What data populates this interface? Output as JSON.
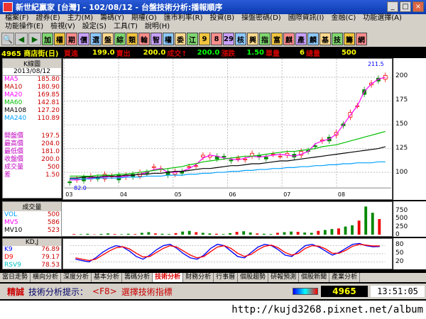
{
  "window": {
    "title": "新世紀贏家 [台灣] - 102/08/12 - 台盤技術分析:播報順序",
    "min": "_",
    "max": "□",
    "close": "×"
  },
  "menu": [
    "檔案(F)",
    "證券(E)",
    "主力(M)",
    "籌碼(Y)",
    "期權(O)",
    "匯市利率(R)",
    "投資(B)",
    "操盤密碼(D)",
    "國際資訊(I)",
    "金融(C)",
    "功能選擇(A)",
    "功能操作(E)",
    "檢視(V)",
    "設定(S)",
    "工具(T)",
    "說明(H)"
  ],
  "toolbar": {
    "icons": [
      "search-icon",
      "back-icon",
      "forward-icon"
    ],
    "buttons": [
      "加",
      "權",
      "期",
      "價",
      "選",
      "盤",
      "綜",
      "類",
      "輪",
      "智",
      "權",
      "委",
      "江",
      "9",
      "8",
      "29",
      "核",
      "興",
      "指",
      "富",
      "麒",
      "產",
      "麟",
      "基",
      "技",
      "籌",
      "網"
    ]
  },
  "info": {
    "code_name": "4965 商店街(日)",
    "buy_label": "買進",
    "buy": "199.0",
    "sell_label": "賣出",
    "sell": "200.0",
    "deal_label": "成交↑",
    "deal": "200.0",
    "change_label": "漲跌",
    "change": "1.50",
    "unit_label": "單量",
    "unit": "6",
    "vol_label": "總量",
    "vol": "500"
  },
  "left_panel": {
    "title": "K線圖",
    "date": "2013/08/12",
    "ma": [
      {
        "label": "MA5",
        "value": "185.80",
        "color": "#ff00ff"
      },
      {
        "label": "MA10",
        "value": "180.90",
        "color": "#c00000"
      },
      {
        "label": "MA20",
        "value": "169.85",
        "color": "#ff00ff"
      },
      {
        "label": "MA60",
        "value": "142.81",
        "color": "#00c000"
      },
      {
        "label": "MA108",
        "value": "127.20",
        "color": "#000000"
      },
      {
        "label": "MA240",
        "value": "110.89",
        "color": "#00a0ff"
      }
    ],
    "prices": [
      {
        "label": "開盤價",
        "value": "197.5"
      },
      {
        "label": "最高價",
        "value": "204.0"
      },
      {
        "label": "最低價",
        "value": "181.0"
      },
      {
        "label": "收盤價",
        "value": "200.0"
      },
      {
        "label": "成交量",
        "value": "500"
      },
      {
        "label": "差",
        "value": "1.50"
      }
    ]
  },
  "chart_data": [
    {
      "type": "line",
      "title": "K線圖",
      "x_ticks": [
        "03",
        "04",
        "05",
        "06",
        "07",
        "08"
      ],
      "annotations": [
        "211.5",
        "82.0"
      ],
      "ylim": [
        85,
        215
      ],
      "y_ticks": [
        100,
        125,
        150,
        175,
        200
      ],
      "series": [
        {
          "name": "MA5",
          "color": "#ff00ff",
          "values": [
            92,
            92,
            93,
            94,
            94,
            95,
            96,
            95,
            96,
            97,
            98,
            100,
            103,
            104,
            100,
            100,
            101,
            104,
            108,
            115,
            118,
            117,
            115,
            114,
            113,
            115,
            117,
            116,
            117,
            118,
            119,
            118,
            117,
            119,
            122,
            130,
            133,
            135,
            140,
            150,
            160,
            170,
            185,
            193,
            198,
            200
          ]
        },
        {
          "name": "MA60",
          "color": "#00c000",
          "values": [
            96,
            96,
            96,
            96,
            97,
            97,
            97,
            98,
            98,
            99,
            100,
            101,
            102,
            103,
            104,
            105,
            106,
            108,
            109,
            111,
            112,
            113,
            114,
            115,
            116,
            117,
            117,
            118,
            119,
            120,
            121,
            122,
            122,
            123,
            124,
            125,
            127,
            128,
            129,
            131,
            133,
            135,
            137,
            139,
            141,
            143
          ]
        },
        {
          "name": "MA108",
          "color": "#000000",
          "values": [
            94,
            94,
            95,
            95,
            95,
            96,
            96,
            96,
            97,
            97,
            98,
            98,
            99,
            99,
            100,
            101,
            101,
            102,
            103,
            104,
            104,
            105,
            106,
            107,
            107,
            108,
            109,
            109,
            110,
            111,
            112,
            112,
            113,
            114,
            115,
            116,
            117,
            118,
            119,
            120,
            121,
            122,
            123,
            124,
            125,
            127
          ]
        },
        {
          "name": "MA240",
          "color": "#00a0ff",
          "values": [
            93,
            93,
            93,
            93,
            94,
            94,
            94,
            94,
            95,
            95,
            95,
            96,
            96,
            96,
            97,
            97,
            97,
            98,
            98,
            99,
            99,
            100,
            100,
            101,
            101,
            102,
            102,
            103,
            103,
            104,
            104,
            105,
            105,
            106,
            106,
            107,
            107,
            108,
            108,
            109,
            109,
            110,
            110,
            110,
            111,
            111
          ]
        }
      ]
    },
    {
      "type": "bar",
      "title": "成交量",
      "labels": [
        {
          "label": "VOL",
          "value": "500",
          "color": "#00a0ff"
        },
        {
          "label": "MV5",
          "value": "586",
          "color": "#ff00ff"
        },
        {
          "label": "MV10",
          "value": "523",
          "color": "#000000"
        }
      ],
      "ylim": [
        0,
        1000
      ],
      "y_ticks": [
        0,
        250,
        500,
        750
      ],
      "values": [
        20,
        15,
        30,
        10,
        25,
        40,
        20,
        15,
        30,
        20,
        60,
        80,
        40,
        30,
        20,
        50,
        100,
        120,
        80,
        60,
        40,
        30,
        20,
        50,
        90,
        110,
        70,
        40,
        30,
        20,
        60,
        80,
        100,
        90,
        70,
        60,
        120,
        150,
        180,
        200,
        260,
        300,
        450,
        900,
        700,
        500
      ]
    },
    {
      "type": "line",
      "title": "KD,J",
      "labels": [
        {
          "label": "K9",
          "value": "76.89",
          "color": "#0000ff"
        },
        {
          "label": "D9",
          "value": "79.17",
          "color": "#ff0000"
        },
        {
          "label": "RSV9",
          "value": "78.53",
          "color": "#00c0c0"
        }
      ],
      "ylim": [
        0,
        100
      ],
      "y_ticks": [
        20,
        50,
        80
      ],
      "series": [
        {
          "name": "K9",
          "color": "#0000ff",
          "values": [
            30,
            25,
            20,
            35,
            55,
            70,
            80,
            75,
            60,
            40,
            30,
            45,
            65,
            80,
            85,
            70,
            50,
            35,
            30,
            45,
            70,
            85,
            80,
            60,
            40,
            35,
            55,
            75,
            85,
            80,
            65,
            45,
            40,
            60,
            80,
            85,
            75,
            60,
            45,
            55,
            70,
            85,
            88,
            80,
            76,
            77
          ]
        },
        {
          "name": "D9",
          "color": "#ff0000",
          "values": [
            35,
            30,
            25,
            30,
            45,
            60,
            72,
            76,
            68,
            52,
            38,
            40,
            55,
            70,
            80,
            75,
            60,
            45,
            35,
            40,
            58,
            75,
            80,
            70,
            52,
            40,
            48,
            65,
            78,
            82,
            72,
            55,
            45,
            52,
            70,
            80,
            78,
            68,
            52,
            52,
            63,
            78,
            85,
            82,
            79,
            79
          ]
        }
      ]
    }
  ],
  "tabs": [
    "當日走勢",
    "橫向分析",
    "深度分析",
    "基本分析",
    "籌碼分析",
    "技術分析",
    "財務分析",
    "行事曆",
    "個股趨勢",
    "研報預測",
    "個股新聞",
    "產業分析"
  ],
  "active_tab": "技術分析",
  "status": {
    "label": "精誠",
    "hint": "技術分析提示：",
    "key": "<F8>",
    "action": "選擇技術指標",
    "code": "4965",
    "time": "13:51:05"
  },
  "watermark": "http://kujd3268.pixnet.net/album"
}
